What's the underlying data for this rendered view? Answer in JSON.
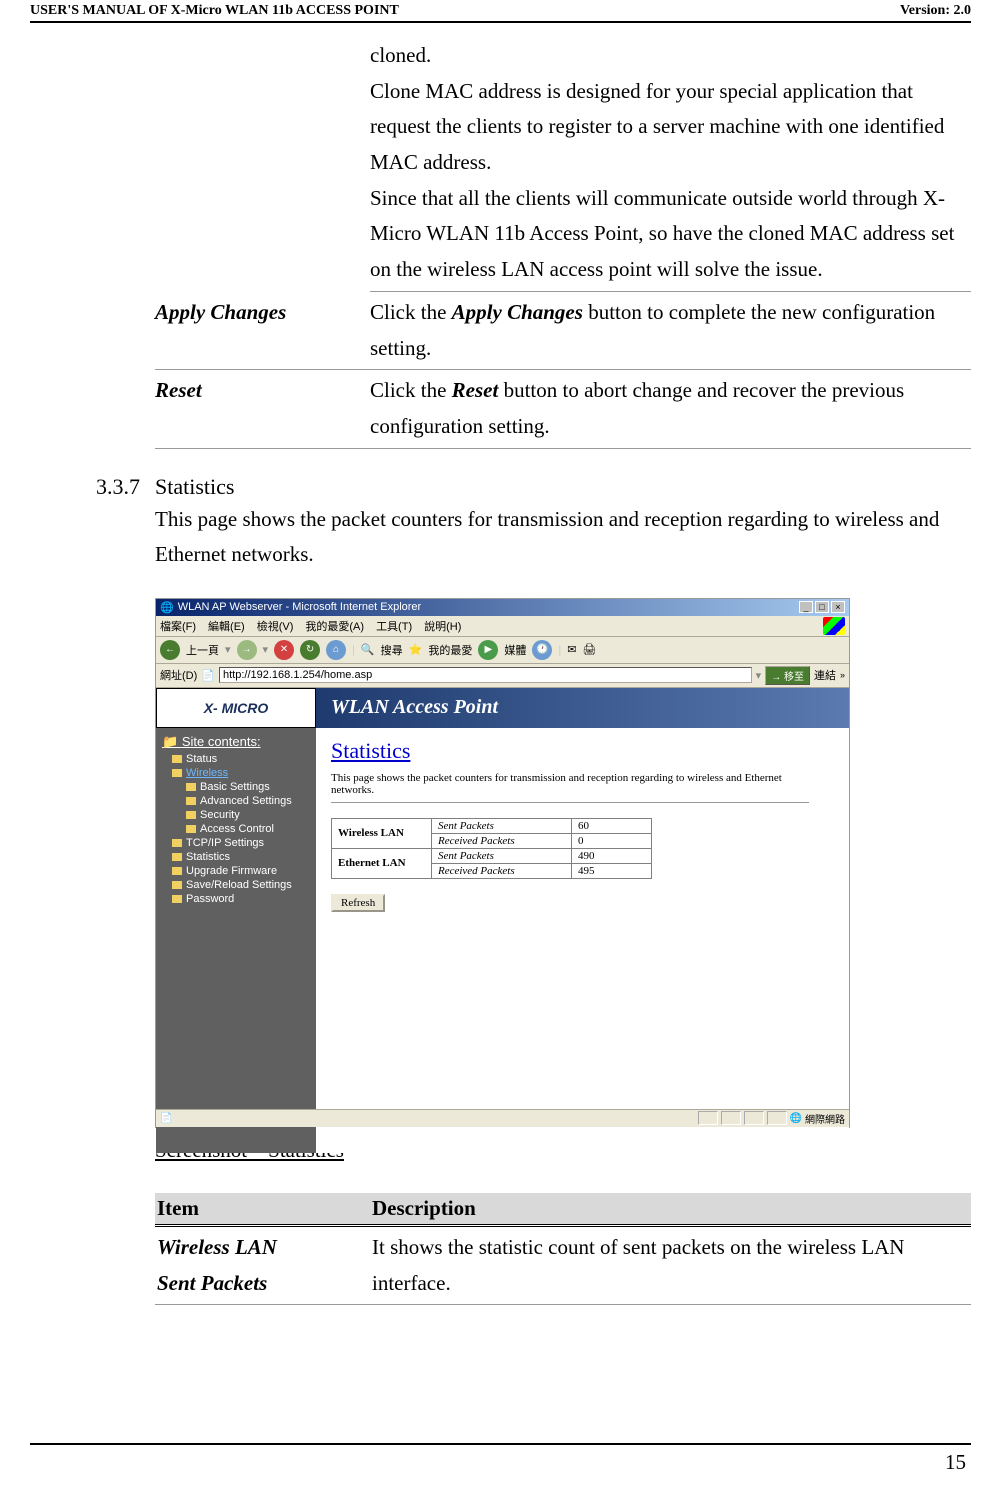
{
  "header": {
    "left": "USER'S MANUAL OF X-Micro WLAN 11b ACCESS POINT",
    "right": "Version: 2.0"
  },
  "top_text": {
    "line1": "cloned.",
    "line2": "Clone MAC address is designed for your special application that request the clients to register to a server machine with one identified MAC address.",
    "line3": "Since that all the clients will communicate outside world through X-Micro WLAN 11b Access Point, so have the cloned MAC address set on the wireless LAN access point will solve the issue."
  },
  "config_rows": {
    "apply": {
      "label": "Apply Changes",
      "text_pre": "Click the ",
      "text_bold": "Apply Changes",
      "text_post": " button to complete the new configuration setting."
    },
    "reset": {
      "label": "Reset",
      "text_pre": "Click the ",
      "text_bold": "Reset",
      "text_post": " button to abort change and recover the previous configuration setting."
    }
  },
  "section": {
    "number": "3.3.7",
    "title": "Statistics",
    "text": "This page shows the packet counters for transmission and reception regarding to wireless and Ethernet networks."
  },
  "screenshot": {
    "titlebar": "WLAN AP Webserver - Microsoft Internet Explorer",
    "menus": [
      "檔案(F)",
      "編輯(E)",
      "檢視(V)",
      "我的最愛(A)",
      "工具(T)",
      "說明(H)"
    ],
    "toolbar": {
      "back": "上一頁",
      "search": "搜尋",
      "favorites": "我的最愛",
      "media": "媒體"
    },
    "address_label": "網址(D)",
    "address_url": "http://192.168.1.254/home.asp",
    "go": "移至",
    "links": "連結",
    "logo": "X- MICRO",
    "page_title": "WLAN Access Point",
    "sidebar_title": "Site contents:",
    "sidebar_items": {
      "status": "Status",
      "wireless": "Wireless",
      "basic": "Basic Settings",
      "advanced": "Advanced Settings",
      "security": "Security",
      "access": "Access Control",
      "tcpip": "TCP/IP Settings",
      "stats": "Statistics",
      "upgrade": "Upgrade Firmware",
      "save": "Save/Reload Settings",
      "password": "Password"
    },
    "main": {
      "heading": "Statistics",
      "desc": "This page shows the packet counters for transmission and reception regarding to wireless and Ethernet networks.",
      "wlan": "Wireless LAN",
      "elan": "Ethernet LAN",
      "sent": "Sent Packets",
      "recv": "Received Packets",
      "wlan_sent": "60",
      "wlan_recv": "0",
      "elan_sent": "490",
      "elan_recv": "495",
      "refresh": "Refresh"
    },
    "statusbar": "網際網路"
  },
  "caption": "Screenshot – Statistics",
  "desc_table": {
    "head_item": "Item",
    "head_desc": "Description",
    "row1_item_line1": "Wireless LAN",
    "row1_item_line2": "Sent Packets",
    "row1_desc": "It shows the statistic count of sent packets on the wireless LAN interface."
  },
  "page_number": "15"
}
